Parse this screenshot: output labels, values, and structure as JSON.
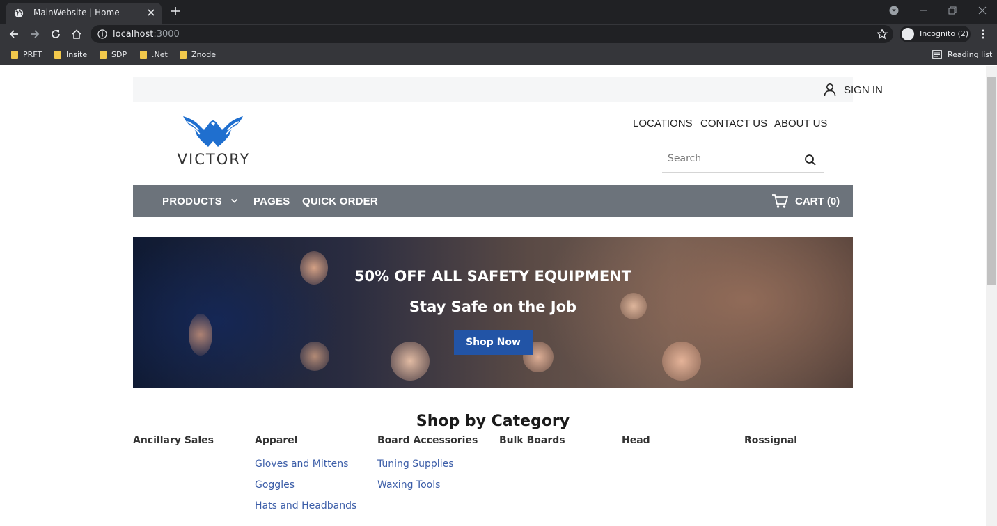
{
  "browser": {
    "tab_title": "_MainWebsite | Home",
    "url_host": "localhost",
    "url_port": ":3000",
    "incognito_label": "Incognito (2)",
    "bookmarks": [
      "PRFT",
      "Insite",
      "SDP",
      ".Net",
      "Znode"
    ],
    "reading_list": "Reading list"
  },
  "header": {
    "sign_in": "SIGN IN",
    "logo_text": "VICTORY",
    "links": [
      "LOCATIONS",
      "CONTACT US",
      "ABOUT US"
    ],
    "search_placeholder": "Search"
  },
  "nav": {
    "products": "PRODUCTS",
    "pages": "PAGES",
    "quick_order": "QUICK ORDER",
    "cart": "CART (0)"
  },
  "hero": {
    "title": "50% OFF ALL SAFETY EQUIPMENT",
    "subtitle": "Stay Safe on the Job",
    "button": "Shop Now"
  },
  "categories": {
    "heading": "Shop by Category",
    "columns": [
      {
        "title": "Ancillary Sales",
        "links": []
      },
      {
        "title": "Apparel",
        "links": [
          "Gloves and Mittens",
          "Goggles",
          "Hats and Headbands"
        ]
      },
      {
        "title": "Board Accessories",
        "links": [
          "Tuning Supplies",
          "Waxing Tools"
        ]
      },
      {
        "title": "Bulk Boards",
        "links": []
      },
      {
        "title": "Head",
        "links": []
      },
      {
        "title": "Rossignal",
        "links": []
      }
    ]
  },
  "colors": {
    "chrome_dark": "#202124",
    "chrome_toolbar": "#35363a",
    "navbar": "#6c737b",
    "button_blue": "#2254a6",
    "link_blue": "#3b5da8",
    "logo_blue": "#1f6fcf"
  }
}
